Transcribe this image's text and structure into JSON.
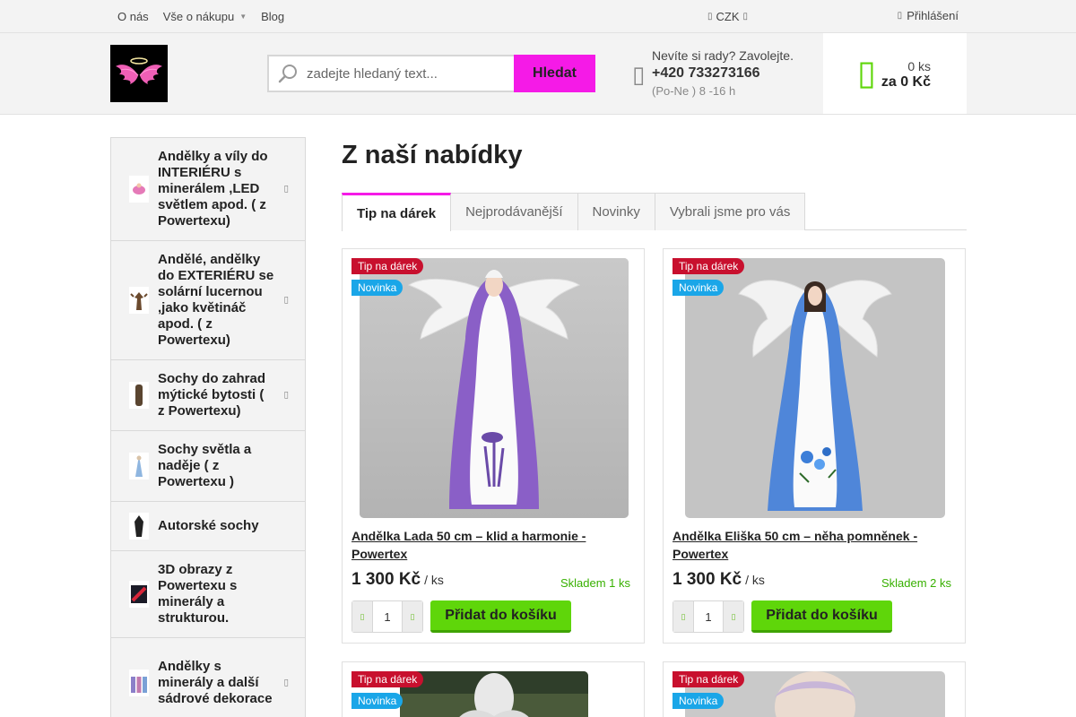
{
  "topbar": {
    "nav": [
      {
        "label": "O nás",
        "dropdown": false
      },
      {
        "label": "Vše o nákupu",
        "dropdown": true
      },
      {
        "label": "Blog",
        "dropdown": false
      }
    ],
    "currency": "CZK",
    "login": "Přihlášení"
  },
  "header": {
    "search_placeholder": "zadejte hledaný text...",
    "search_button": "Hledat",
    "contact_line1": "Nevíte si rady? Zavolejte.",
    "contact_phone": "+420 733273166",
    "contact_hours": "(Po-Ne ) 8 -16 h",
    "cart_count": "0 ks",
    "cart_total": "za 0 Kč"
  },
  "sidebar": {
    "items": [
      {
        "label": "Andělky a víly do INTERIÉRU s minerálem ,LED světlem apod. ( z Powertexu)",
        "has_submenu": true
      },
      {
        "label": "Andělé, andělky do EXTERIÉRU se solární lucernou ,jako květináč apod. ( z Powertexu)",
        "has_submenu": true
      },
      {
        "label": "Sochy do zahrad mýtické bytosti ( z Powertexu)",
        "has_submenu": true
      },
      {
        "label": "Sochy světla a naděje ( z Powertexu )",
        "has_submenu": false
      },
      {
        "label": "Autorské sochy",
        "has_submenu": false
      },
      {
        "label": "3D obrazy z Powertexu s minerály a strukturou.",
        "has_submenu": false
      },
      {
        "label": "Andělky s minerály a další sádrové dekorace",
        "has_submenu": true
      }
    ]
  },
  "main": {
    "title": "Z naší nabídky",
    "tabs": [
      {
        "label": "Tip na dárek",
        "active": true
      },
      {
        "label": "Nejprodávanější",
        "active": false
      },
      {
        "label": "Novinky",
        "active": false
      },
      {
        "label": "Vybrali jsme pro vás",
        "active": false
      }
    ],
    "products": [
      {
        "flag_tip": "Tip na dárek",
        "flag_new": "Novinka",
        "name": "Andělka Lada 50 cm – klid a harmonie - Powertex",
        "price": "1 300 Kč",
        "unit": "/ ks",
        "stock": "Skladem 1 ks",
        "qty": "1",
        "add_label": "Přidat do košíku"
      },
      {
        "flag_tip": "Tip na dárek",
        "flag_new": "Novinka",
        "name": "Andělka Eliška 50 cm – něha pomněnek - Powertex",
        "price": "1 300 Kč",
        "unit": "/ ks",
        "stock": "Skladem 2 ks",
        "qty": "1",
        "add_label": "Přidat do košíku"
      },
      {
        "flag_tip": "Tip na dárek",
        "flag_new": "Novinka"
      },
      {
        "flag_tip": "Tip na dárek",
        "flag_new": "Novinka"
      }
    ]
  },
  "colors": {
    "accent_pink": "#f51ae7",
    "cart_green": "#5fd60a",
    "stock_green": "#37b000",
    "flag_red": "#c8102e",
    "flag_blue": "#1aa6e8"
  }
}
